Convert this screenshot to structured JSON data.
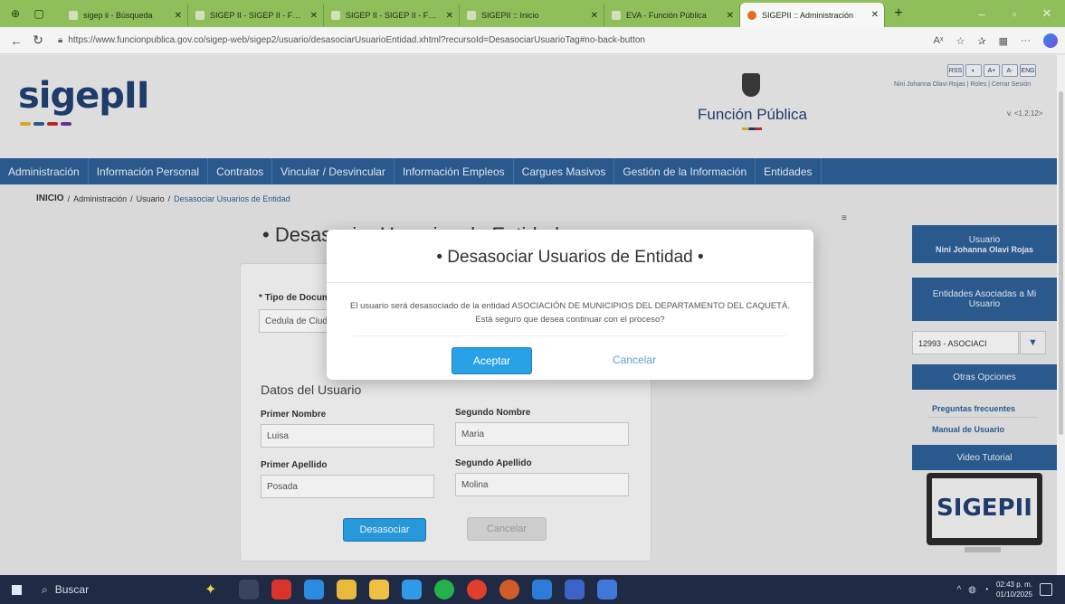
{
  "browser": {
    "tabs": [
      {
        "label": "sigep ii - Búsqueda"
      },
      {
        "label": "SIGEP II - SIGEP II - Funció"
      },
      {
        "label": "SIGEP II - SIGEP II - Funció"
      },
      {
        "label": "SIGEPII :: Inicio"
      },
      {
        "label": "EVA - Función Pública"
      },
      {
        "label": "SIGEPII :: Administración"
      }
    ],
    "url": "https://www.funcionpublica.gov.co/sigep-web/sigep2/usuario/desasociarUsuarioEntidad.xhtml?recursoId=DesasociarUsuarioTag#no-back-button"
  },
  "header": {
    "logo_text": "sigepII",
    "org_name": "Función Pública",
    "user_name_small": "Nini Johanna Olavi Rojas",
    "roles_link": "Roles",
    "logout_link": "Cerrar Sesión",
    "version": "v. <1.2.12>",
    "access_buttons": [
      "RSS",
      "◐",
      "A+",
      "A-",
      "ENG"
    ]
  },
  "menu": [
    "Administración",
    "Información Personal",
    "Contratos",
    "Vincular / Desvincular",
    "Información Empleos",
    "Cargues Masivos",
    "Gestión de la Información",
    "Entidades"
  ],
  "breadcrumb": {
    "home": "INICIO",
    "sep": "/",
    "level1": "Administración",
    "level2": "Usuario",
    "current": "Desasociar Usuarios de Entidad"
  },
  "page": {
    "title": "• Desasociar Usuarios de Entidad •",
    "doc_type_label": "* Tipo de Documento",
    "doc_type_value": "Cedula de Ciudadanía",
    "section_title": "Datos del Usuario",
    "first_name_label": "Primer Nombre",
    "first_name_value": "Luisa",
    "second_name_label": "Segundo Nombre",
    "second_name_value": "Maria",
    "first_surname_label": "Primer Apellido",
    "first_surname_value": "Posada",
    "second_surname_label": "Segundo Apellido",
    "second_surname_value": "Molina",
    "dissociate_button": "Desasociar",
    "cancel_button": "Cancelar"
  },
  "sidebar": {
    "user_heading": "Usuario",
    "user_name": "Nini Johanna Olavi Rojas",
    "entities_heading": "Entidades Asociadas a Mi Usuario",
    "entity_selected": "12993 - ASOCIACI",
    "other_options_heading": "Otras Opciones",
    "faq_link": "Preguntas frecuentes",
    "manual_link": "Manual de Usuario",
    "video_heading": "Video Tutorial",
    "video_logo": "SIGEPII"
  },
  "modal": {
    "title": "• Desasociar Usuarios de Entidad •",
    "message": "El usuario será desasociado de la entidad ASOCIACIÓN DE MUNICIPIOS DEL DEPARTAMENTO DEL CAQUETÁ. Está seguro que desea continuar con el proceso?",
    "accept": "Aceptar",
    "cancel": "Cancelar"
  },
  "taskbar": {
    "search_placeholder": "Buscar",
    "time": "02:43 p. m.",
    "date": "01/10/2025"
  },
  "colors": {
    "menu_blue": "#2c5f96",
    "button_blue": "#29a1e6",
    "tab_green": "#8fbf5a"
  }
}
